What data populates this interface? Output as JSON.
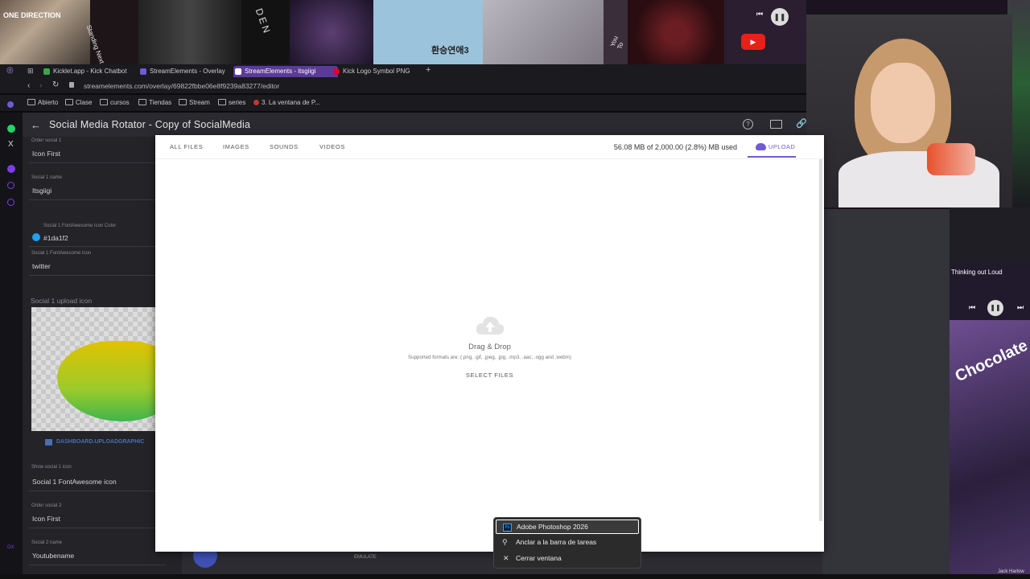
{
  "browser": {
    "tabs": [
      {
        "label": "Kicklet.app - Kick Chatbot",
        "color": "#3fa34d"
      },
      {
        "label": "StreamElements - Overlay",
        "color": "#6f5bd6"
      },
      {
        "label": "StreamElements - itsgiigi",
        "color": "#6f5bd6",
        "active": true
      },
      {
        "label": "Kick Logo Symbol PNG",
        "color": "#e60023"
      }
    ],
    "new_tab": "+",
    "url": "streamelements.com/overlay/69822fbbe06e8f9239a83277/editor",
    "bookmarks": [
      "Abierto",
      "Clase",
      "cursos",
      "Tiendas",
      "Stream",
      "series",
      "3. La ventana de P..."
    ]
  },
  "editor": {
    "title": "Social Media Rotator - Copy of SocialMedia",
    "fields": [
      {
        "label": "Order social 1",
        "value": "Icon First"
      },
      {
        "label": "Social 1 name",
        "value": "Itsgiigi"
      },
      {
        "label": "Social 1 FontAwesome Icon Color",
        "value": "#1da1f2"
      },
      {
        "label": "Social 1 FontAwesome Icon",
        "value": "twitter"
      }
    ],
    "upload_section_label": "Social 1 upload icon",
    "upload_link": "DASHBOARD.UPLOADGRAPHIC",
    "fields_after": [
      {
        "label": "Show social 1 icon",
        "value": "Social 1 FontAwesome icon"
      },
      {
        "label": "Order social 2",
        "value": "Icon First"
      },
      {
        "label": "Social 2 name",
        "value": "Youtubename"
      }
    ],
    "emulate_label": "EMULATE",
    "accent_color": "#1da1f2"
  },
  "modal": {
    "tabs": [
      "ALL FILES",
      "IMAGES",
      "SOUNDS",
      "VIDEOS"
    ],
    "usage": "56.08 MB of 2,000.00 (2.8%) MB used",
    "upload_tab": "UPLOAD",
    "drag_drop": "Drag & Drop",
    "formats": "Supported formats are: (.png, .gif, .jpeg, .jpg, .mp3, .aac, .ogg and .webm)",
    "select_files": "SELECT FILES"
  },
  "context_menu": {
    "items": [
      {
        "label": "Adobe Photoshop 2026",
        "icon": "photoshop-icon",
        "selected": true
      },
      {
        "label": "Anclar a la barra de tareas",
        "icon": "pin-icon"
      },
      {
        "label": "Cerrar ventana",
        "icon": "close-icon"
      }
    ]
  },
  "stream_overlay": {
    "song_title": "Thinking out Loud",
    "album_text": "Chocolate",
    "artist_small": "Jack Harlow",
    "collage_texts": [
      "ONE DIRECTION",
      "Standing Next to You",
      "DEN",
      "환승연애3",
      "You To"
    ]
  }
}
